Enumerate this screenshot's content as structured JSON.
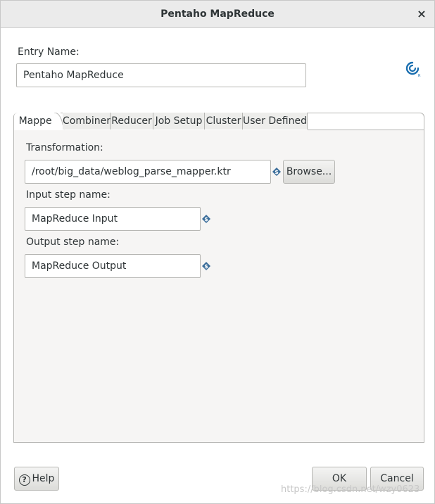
{
  "window": {
    "title": "Pentaho MapReduce",
    "close_glyph": "×"
  },
  "entry": {
    "label": "Entry Name:",
    "value": "Pentaho MapReduce"
  },
  "logo": {
    "icon": "pentaho-spiral-icon",
    "mark": "R",
    "color": "#1a6fb0"
  },
  "tabs": [
    {
      "label": "Mapper",
      "active": true
    },
    {
      "label": "Combiner",
      "active": false
    },
    {
      "label": "Reducer",
      "active": false
    },
    {
      "label": "Job Setup",
      "active": false
    },
    {
      "label": "Cluster",
      "active": false
    },
    {
      "label": "User Defined",
      "active": false
    }
  ],
  "mapper": {
    "transformation_label": "Transformation:",
    "transformation_value": "/root/big_data/weblog_parse_mapper.ktr",
    "browse_label": "Browse...",
    "input_label": "Input step name:",
    "input_value": "MapReduce Input",
    "output_label": "Output step name:",
    "output_value": "MapReduce Output"
  },
  "variable_icon": {
    "name": "variable-diamond-icon",
    "color": "#3a6d9a",
    "glyph": "$"
  },
  "footer": {
    "help_label": "Help",
    "help_glyph": "?",
    "ok_label": "OK",
    "cancel_label": "Cancel"
  },
  "watermark": "https://blog.csdn.net/wzy0623"
}
